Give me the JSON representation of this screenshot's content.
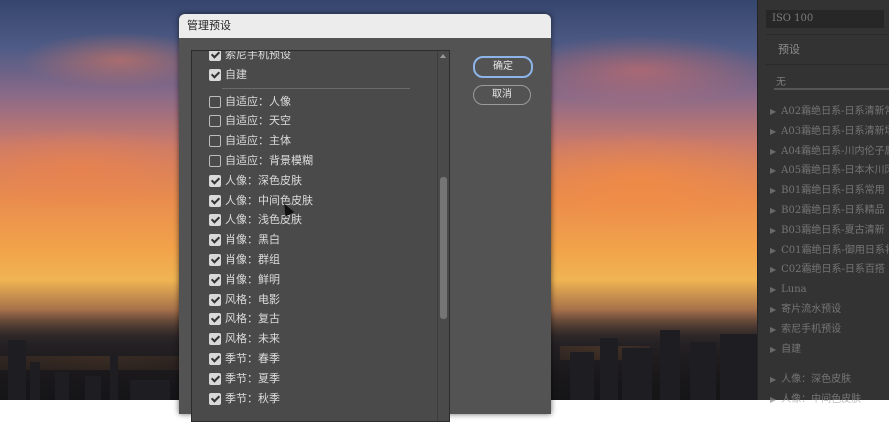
{
  "dialog": {
    "title": "管理预设",
    "ok_label": "确定",
    "cancel_label": "取消",
    "items": [
      {
        "label": "索尼手机预设",
        "checked": true
      },
      {
        "label": "自建",
        "checked": true
      },
      {
        "separator": true
      },
      {
        "label": "自适应：人像",
        "checked": false
      },
      {
        "label": "自适应：天空",
        "checked": false
      },
      {
        "label": "自适应：主体",
        "checked": false
      },
      {
        "label": "自适应：背景模糊",
        "checked": false
      },
      {
        "label": "人像：深色皮肤",
        "checked": true
      },
      {
        "label": "人像：中间色皮肤",
        "checked": true
      },
      {
        "label": "人像：浅色皮肤",
        "checked": true
      },
      {
        "label": "肖像：黑白",
        "checked": true
      },
      {
        "label": "肖像：群组",
        "checked": true
      },
      {
        "label": "肖像：鲜明",
        "checked": true
      },
      {
        "label": "风格：电影",
        "checked": true
      },
      {
        "label": "风格：复古",
        "checked": true
      },
      {
        "label": "风格：未来",
        "checked": true
      },
      {
        "label": "季节：春季",
        "checked": true
      },
      {
        "label": "季节：夏季",
        "checked": true
      },
      {
        "label": "季节：秋季",
        "checked": true
      }
    ]
  },
  "right_panel": {
    "iso": "ISO 100",
    "preset_title": "预设",
    "preset_value": "无",
    "groups": [
      "A02霜绝日系-日系清新常",
      "A03霜绝日系-日系清新场",
      "A04霜绝日系-川内伦子唇",
      "A05霜绝日系-日本木川冈",
      "B01霜绝日系-日系常用",
      "B02霜绝日系-日系精品",
      "B03霜绝日系-夏古清新",
      "C01霜绝日系-御用日系将",
      "C02霜绝日系-日系百搭",
      "Luna",
      "寄片流水预设",
      "索尼手机预设",
      "自建"
    ],
    "groups2": [
      "人像：深色皮肤",
      "人像：中间色皮肤"
    ]
  }
}
